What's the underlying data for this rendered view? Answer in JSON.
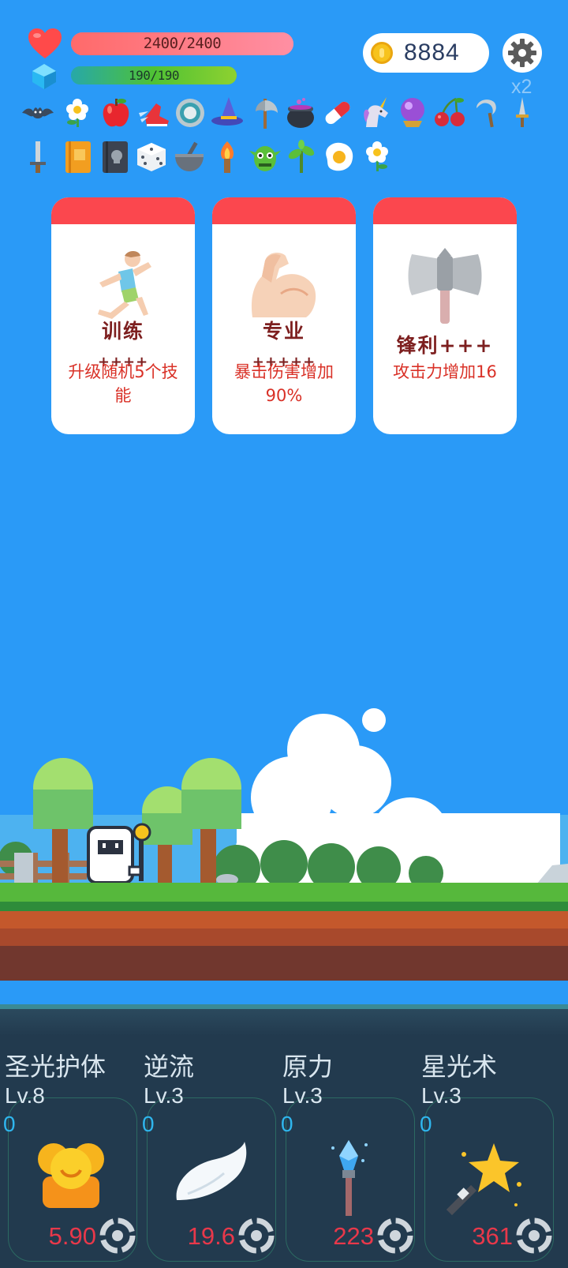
{
  "hud": {
    "hp_text": "2400/2400",
    "hp_fraction": 1.0,
    "mp_text": "190/190",
    "mp_fraction": 1.0,
    "coins": "8884",
    "speed_label": "x2"
  },
  "items_row1": [
    "bat",
    "flower",
    "apple",
    "winged-shoe",
    "ring",
    "wizard-hat",
    "axe",
    "cauldron",
    "pill",
    "unicorn",
    "crystal-ball",
    "cherry",
    "sickle",
    "dagger"
  ],
  "items_row2": [
    "sword",
    "spellbook",
    "skull-book",
    "dice",
    "mortar",
    "torch",
    "goblin",
    "sapling",
    "fried-egg",
    "daisy"
  ],
  "cards": [
    {
      "icon": "runner",
      "title": "训练",
      "plus": "++++",
      "desc": "升级随机5个技能"
    },
    {
      "icon": "muscle",
      "title": "专业",
      "plus": "+++++",
      "desc": "暴击伤害增加90%"
    },
    {
      "icon": "battle-axe",
      "title": "锋利+++",
      "plus": "",
      "desc": "攻击力增加16"
    }
  ],
  "skills": [
    {
      "name": "圣光护体",
      "level": "Lv.8",
      "count": "0",
      "value": "5.90",
      "icon": "holy-shield"
    },
    {
      "name": "逆流",
      "level": "Lv.3",
      "count": "0",
      "value": "19.6",
      "icon": "wing"
    },
    {
      "name": "原力",
      "level": "Lv.3",
      "count": "0",
      "value": "223",
      "icon": "crystal-staff"
    },
    {
      "name": "星光术",
      "level": "Lv.3",
      "count": "0",
      "value": "361",
      "icon": "star-wand"
    }
  ],
  "colors": {
    "sky": "#2a9af7",
    "card_header": "#fb474e",
    "panel": "#223a4e",
    "skill_value": "#e8384a"
  }
}
